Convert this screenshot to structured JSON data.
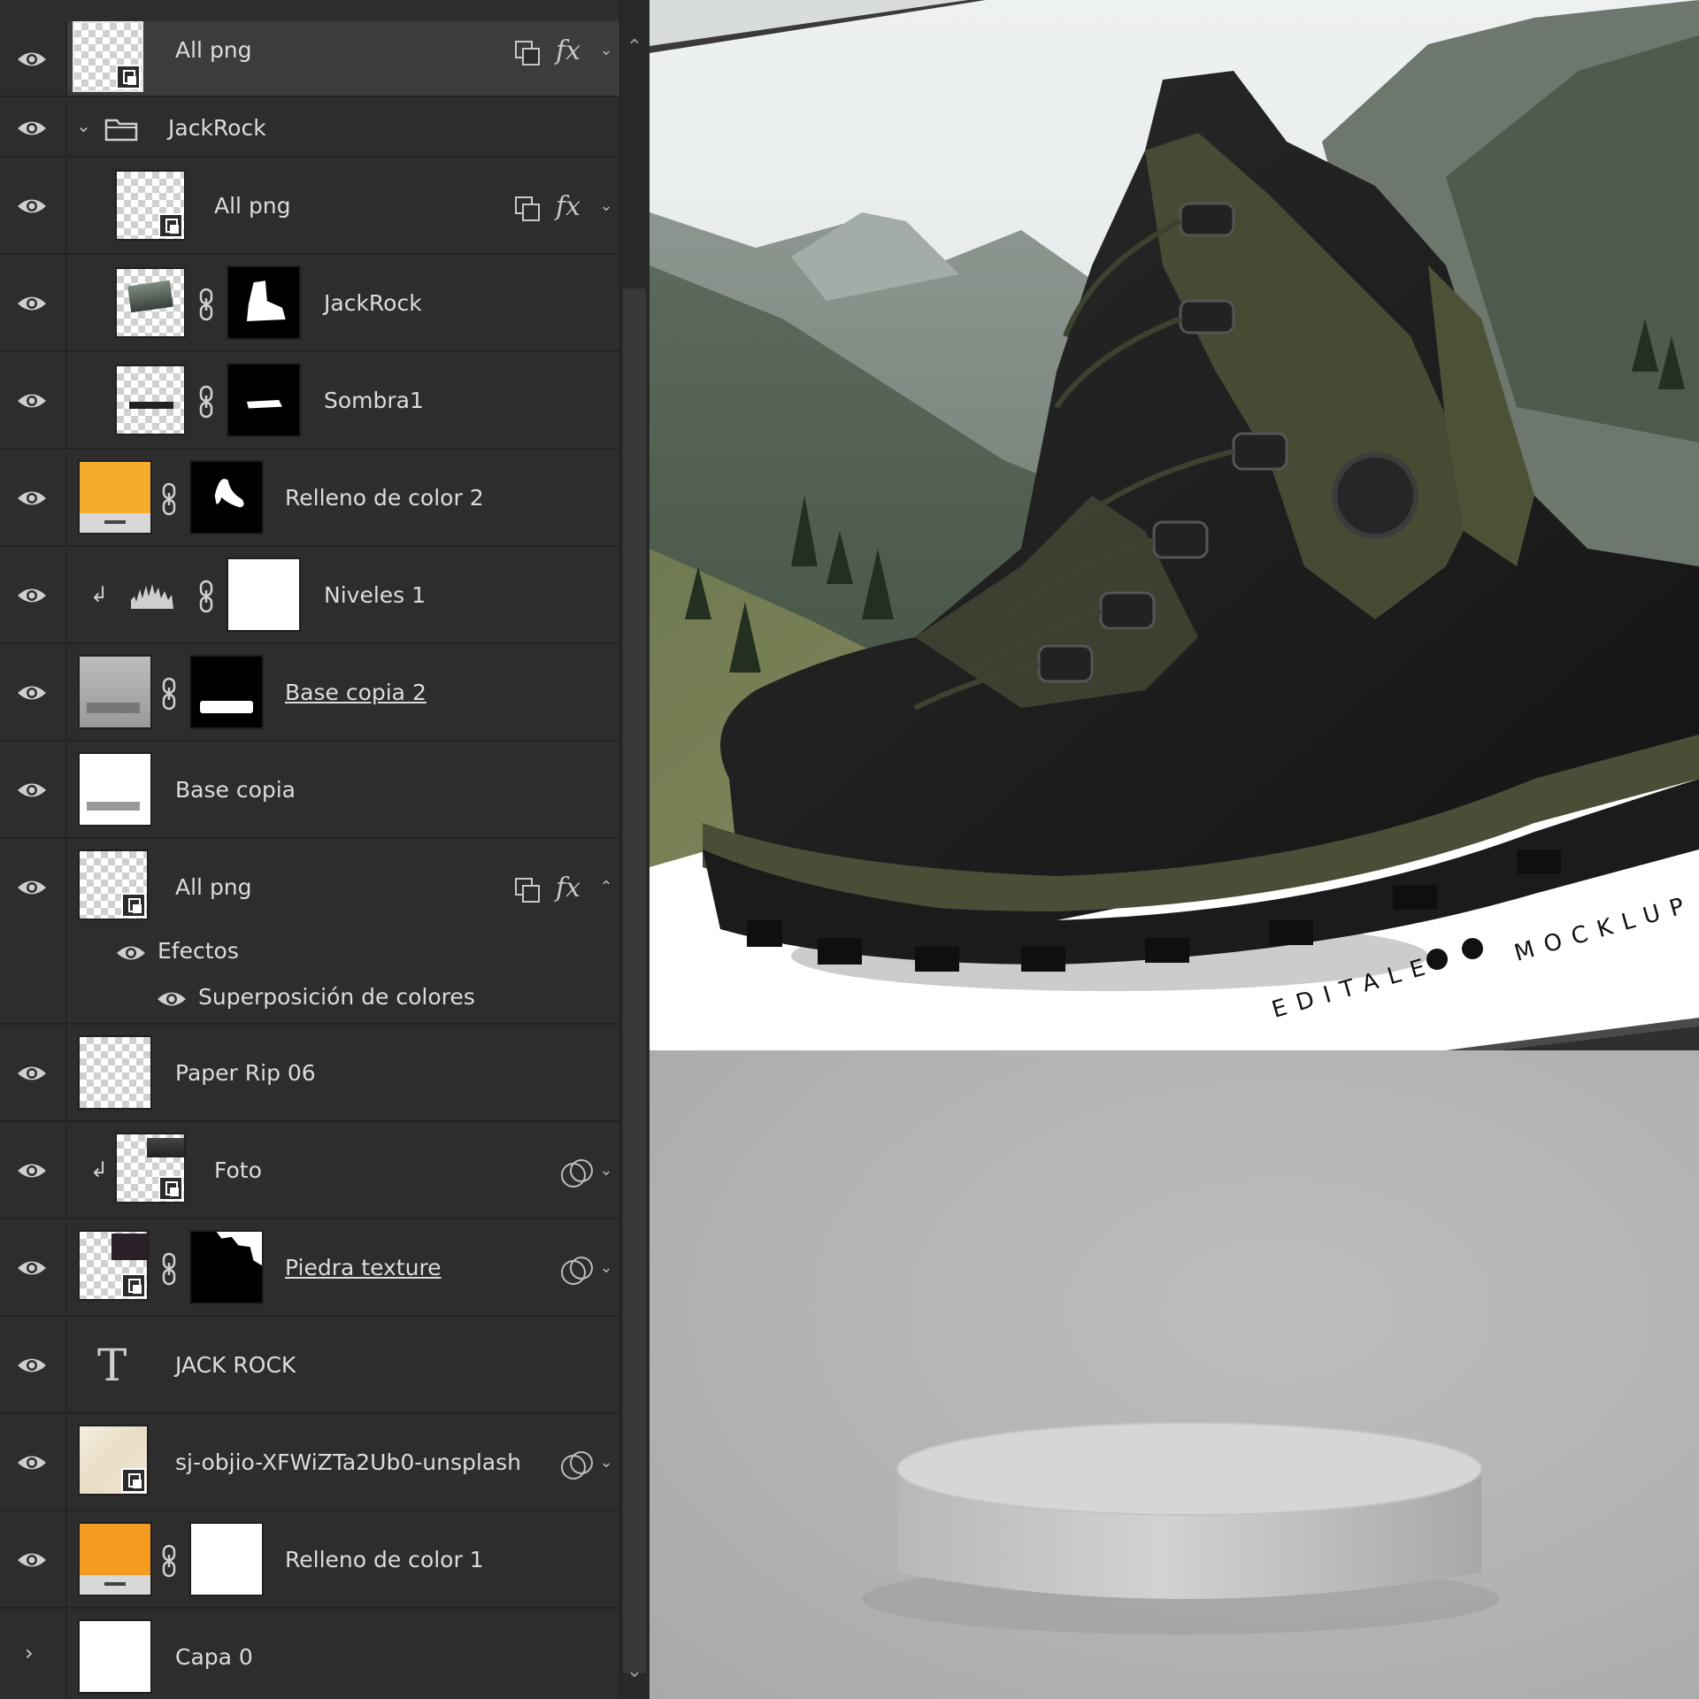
{
  "layers": [
    {
      "id": "all-png-top",
      "label": "All png",
      "selected": true,
      "fx": true,
      "caret": "down",
      "kind": "smart"
    },
    {
      "id": "jackrock-group",
      "label": "JackRock",
      "kind": "group",
      "caret": "down"
    },
    {
      "id": "all-png-group",
      "label": "All png",
      "fx": true,
      "caret": "down",
      "kind": "smart"
    },
    {
      "id": "jackrock-layer",
      "label": "JackRock",
      "kind": "masked"
    },
    {
      "id": "sombra1",
      "label": "Sombra1",
      "kind": "masked"
    },
    {
      "id": "relleno2",
      "label": "Relleno de color 2",
      "kind": "fill",
      "color": "#f5ac2a"
    },
    {
      "id": "niveles1",
      "label": "Niveles 1",
      "kind": "levels"
    },
    {
      "id": "base-copia-2",
      "label": "Base copia 2",
      "kind": "masked",
      "underlined": true
    },
    {
      "id": "base-copia",
      "label": "Base copia",
      "kind": "plain"
    },
    {
      "id": "all-png-effects",
      "label": "All png",
      "fx": true,
      "caret": "up",
      "kind": "smart"
    },
    {
      "id": "paper-rip",
      "label": "Paper Rip 06",
      "kind": "plain"
    },
    {
      "id": "foto",
      "label": "Foto",
      "kind": "smart"
    },
    {
      "id": "piedra",
      "label": "Piedra texture",
      "kind": "masked",
      "underlined": true
    },
    {
      "id": "jack-rock-text",
      "label": "JACK ROCK",
      "kind": "text"
    },
    {
      "id": "unsplash",
      "label": "sj-objio-XFWiZTa2Ub0-unsplash",
      "kind": "smart"
    },
    {
      "id": "relleno1",
      "label": "Relleno de color 1",
      "kind": "fill",
      "color": "#f39c1f"
    },
    {
      "id": "capa0",
      "label": "Capa 0",
      "kind": "plain"
    }
  ],
  "effects": {
    "header": "Efectos",
    "item": "Superposición de colores"
  },
  "text_layer_glyph": "T",
  "fx_symbol": "fx",
  "mockup": {
    "brand_text": "EDITALE",
    "product_text": "MOCKLUP"
  },
  "colors": {
    "panel_bg": "#2d2d2d",
    "selected_row": "#3c3c3c",
    "fill_orange_2": "#f5ac2a",
    "fill_orange_1": "#f39c1f",
    "canvas_grey": "#b3b3b3"
  }
}
